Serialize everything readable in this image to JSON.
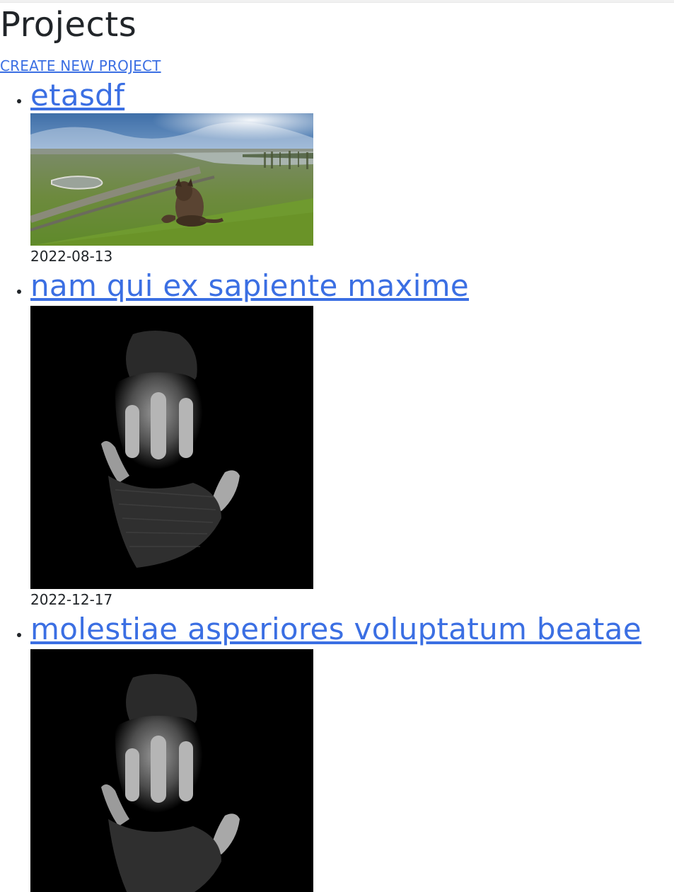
{
  "page": {
    "title": "Projects",
    "create_link_label": "CREATE NEW PROJECT"
  },
  "projects": [
    {
      "title": "etasdf",
      "date": "2022-08-13",
      "image": "dog-on-hill-landscape-photo"
    },
    {
      "title": "nam qui ex sapiente maxime",
      "date": "2022-12-17",
      "image": "hand-in-darkness-photo"
    },
    {
      "title": "molestiae asperiores voluptatum beatae",
      "date": "",
      "image": "hand-in-darkness-photo"
    }
  ],
  "colors": {
    "link": "#3b6fe3",
    "text": "#212529",
    "background": "#ffffff"
  }
}
